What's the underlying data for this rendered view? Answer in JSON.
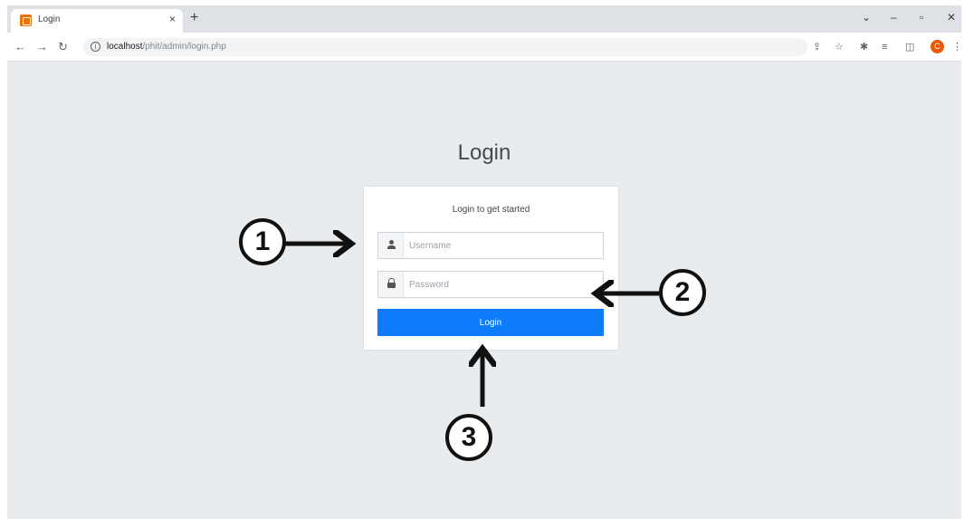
{
  "browser": {
    "tab_title": "Login",
    "tab_close": "×",
    "new_tab": "+",
    "url_host": "localhost",
    "url_path": "/phit/admin/login.php",
    "profile_initial": "C",
    "icons": [
      "back-arrow",
      "forward-arrow",
      "reload",
      "info",
      "share",
      "star",
      "extensions",
      "media",
      "sidebar",
      "profile",
      "menu"
    ],
    "window_controls": [
      "chevron-down",
      "minimize",
      "restore",
      "close"
    ]
  },
  "page": {
    "title": "Login",
    "card_message": "Login to get started",
    "username_placeholder": "Username",
    "password_placeholder": "Password",
    "login_button": "Login",
    "button_color": "#0d7bfa",
    "background_color": "#e9ecef"
  },
  "annotations": [
    "1",
    "2",
    "3"
  ]
}
